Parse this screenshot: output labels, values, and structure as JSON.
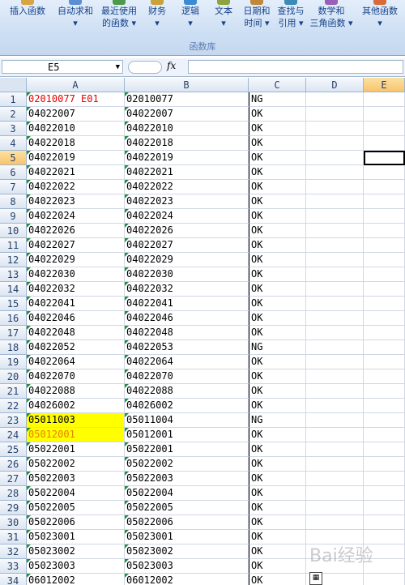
{
  "ribbon": {
    "buttons": [
      {
        "line1": "插入函数",
        "line2": ""
      },
      {
        "line1": "自动求和",
        "line2": "▾"
      },
      {
        "line1": "最近使用",
        "line2": "的函数 ▾"
      },
      {
        "line1": "财务",
        "line2": "▾"
      },
      {
        "line1": "逻辑",
        "line2": "▾"
      },
      {
        "line1": "文本",
        "line2": "▾"
      },
      {
        "line1": "日期和",
        "line2": "时间 ▾"
      },
      {
        "line1": "查找与",
        "line2": "引用 ▾"
      },
      {
        "line1": "数学和",
        "line2": "三角函数 ▾"
      },
      {
        "line1": "其他函数",
        "line2": "▾"
      }
    ],
    "group_label": "函数库"
  },
  "formula_bar": {
    "name_box": "E5",
    "fx_label": "fx",
    "formula": ""
  },
  "columns": [
    "A",
    "B",
    "C",
    "D",
    "E"
  ],
  "selected_cell": "E5",
  "rows": [
    {
      "n": "1",
      "a": "02010077 E01",
      "b": "02010077",
      "c": "NG"
    },
    {
      "n": "2",
      "a": "04022007",
      "b": "04022007",
      "c": "OK"
    },
    {
      "n": "3",
      "a": "04022010",
      "b": "04022010",
      "c": "OK"
    },
    {
      "n": "4",
      "a": "04022018",
      "b": "04022018",
      "c": "OK"
    },
    {
      "n": "5",
      "a": "04022019",
      "b": "04022019",
      "c": "OK"
    },
    {
      "n": "6",
      "a": "04022021",
      "b": "04022021",
      "c": "OK"
    },
    {
      "n": "7",
      "a": "04022022",
      "b": "04022022",
      "c": "OK"
    },
    {
      "n": "8",
      "a": "04022023",
      "b": "04022023",
      "c": "OK"
    },
    {
      "n": "9",
      "a": "04022024",
      "b": "04022024",
      "c": "OK"
    },
    {
      "n": "10",
      "a": "04022026",
      "b": "04022026",
      "c": "OK"
    },
    {
      "n": "11",
      "a": "04022027",
      "b": "04022027",
      "c": "OK"
    },
    {
      "n": "12",
      "a": "04022029",
      "b": "04022029",
      "c": "OK"
    },
    {
      "n": "13",
      "a": "04022030",
      "b": "04022030",
      "c": "OK"
    },
    {
      "n": "14",
      "a": "04022032",
      "b": "04022032",
      "c": "OK"
    },
    {
      "n": "15",
      "a": "04022041",
      "b": "04022041",
      "c": "OK"
    },
    {
      "n": "16",
      "a": "04022046",
      "b": "04022046",
      "c": "OK"
    },
    {
      "n": "17",
      "a": "04022048",
      "b": "04022048",
      "c": "OK"
    },
    {
      "n": "18",
      "a": "04022052",
      "b": "04022053",
      "c": "NG"
    },
    {
      "n": "19",
      "a": "04022064",
      "b": "04022064",
      "c": "OK"
    },
    {
      "n": "20",
      "a": "04022070",
      "b": "04022070",
      "c": "OK"
    },
    {
      "n": "21",
      "a": "04022088",
      "b": "04022088",
      "c": "OK"
    },
    {
      "n": "22",
      "a": "04026002",
      "b": "04026002",
      "c": "OK"
    },
    {
      "n": "23",
      "a": "05011003",
      "b": "05011004",
      "c": "NG"
    },
    {
      "n": "24",
      "a": "05012001",
      "b": "05012001",
      "c": "OK"
    },
    {
      "n": "25",
      "a": "05022001",
      "b": "05022001",
      "c": "OK"
    },
    {
      "n": "26",
      "a": "05022002",
      "b": "05022002",
      "c": "OK"
    },
    {
      "n": "27",
      "a": "05022003",
      "b": "05022003",
      "c": "OK"
    },
    {
      "n": "28",
      "a": "05022004",
      "b": "05022004",
      "c": "OK"
    },
    {
      "n": "29",
      "a": "05022005",
      "b": "05022005",
      "c": "OK"
    },
    {
      "n": "30",
      "a": "05022006",
      "b": "05022006",
      "c": "OK"
    },
    {
      "n": "31",
      "a": "05023001",
      "b": "05023001",
      "c": "OK"
    },
    {
      "n": "32",
      "a": "05023002",
      "b": "05023002",
      "c": "OK"
    },
    {
      "n": "33",
      "a": "05023003",
      "b": "05023003",
      "c": "OK"
    },
    {
      "n": "34",
      "a": "06012002",
      "b": "06012002",
      "c": "OK"
    }
  ],
  "highlight": {
    "red_text_rows": [
      "1"
    ],
    "yellow_rows": [
      "23",
      "24"
    ],
    "orange_text_rows": [
      "24"
    ],
    "fill_color": "#ffff00",
    "red_color": "#e30000",
    "orange_color": "#e68000"
  },
  "watermark": "Bai经验"
}
